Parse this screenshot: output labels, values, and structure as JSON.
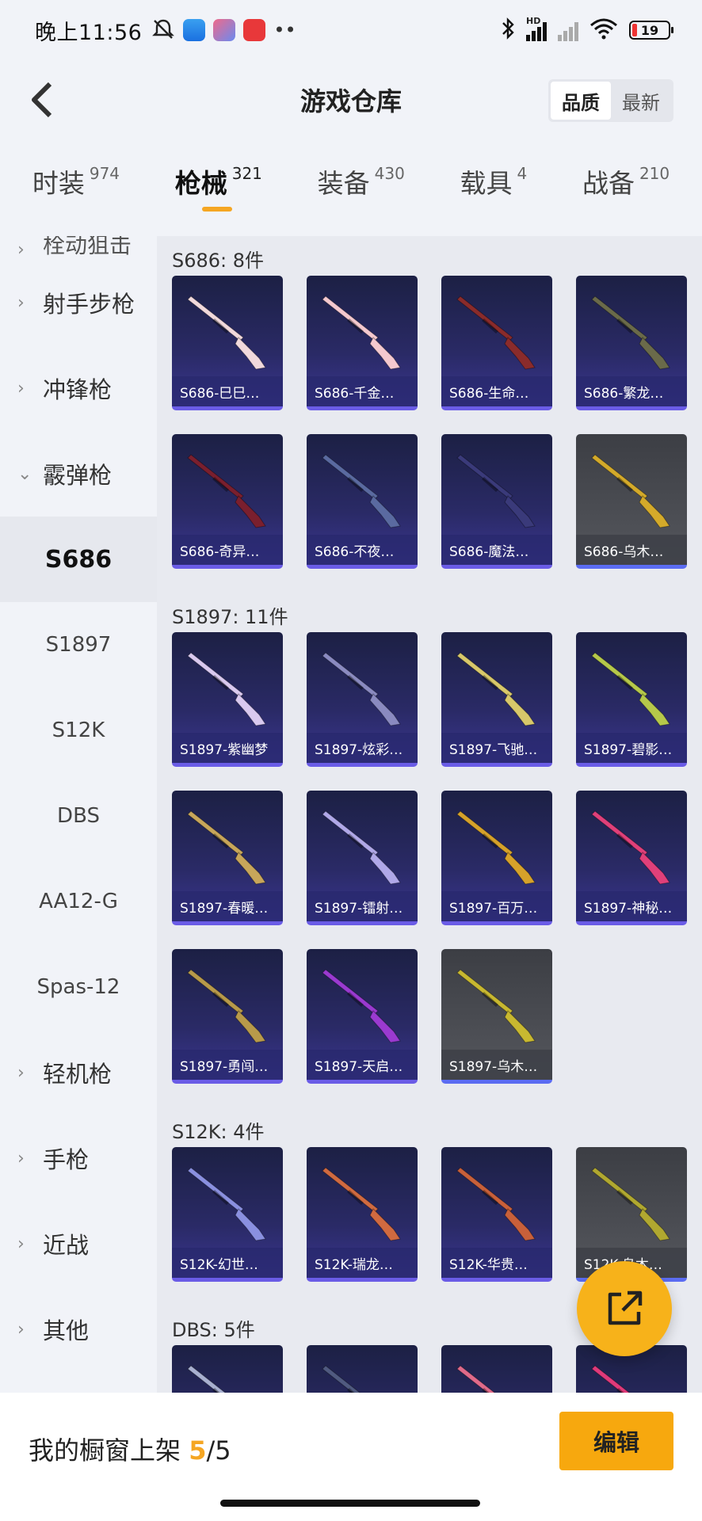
{
  "status": {
    "time": "晚上11:56",
    "battery": "19",
    "network": "HD"
  },
  "header": {
    "title": "游戏仓库",
    "sort_options": [
      "品质",
      "最新"
    ]
  },
  "tabs": [
    {
      "label": "时装",
      "count": "974"
    },
    {
      "label": "枪械",
      "count": "321"
    },
    {
      "label": "装备",
      "count": "430"
    },
    {
      "label": "载具",
      "count": "4"
    },
    {
      "label": "战备",
      "count": "210"
    }
  ],
  "sidebar": {
    "partial_top": "栓动狙击",
    "items": [
      {
        "label": "射手步枪"
      },
      {
        "label": "冲锋枪"
      },
      {
        "label": "霰弹枪"
      }
    ],
    "sub_items": [
      {
        "label": "S686"
      },
      {
        "label": "S1897"
      },
      {
        "label": "S12K"
      },
      {
        "label": "DBS"
      },
      {
        "label": "AA12-G"
      },
      {
        "label": "Spas-12"
      }
    ],
    "more_items": [
      {
        "label": "轻机枪"
      },
      {
        "label": "手枪"
      },
      {
        "label": "近战"
      },
      {
        "label": "其他"
      }
    ]
  },
  "groups": [
    {
      "title": "S686: 8件",
      "items": [
        {
          "name": "S686-巳巳…",
          "grey": false,
          "color": "#f1d9dc"
        },
        {
          "name": "S686-千金…",
          "grey": false,
          "color": "#f4c9cf"
        },
        {
          "name": "S686-生命…",
          "grey": false,
          "color": "#8a2b2b"
        },
        {
          "name": "S686-繁龙…",
          "grey": false,
          "color": "#6a6a4a"
        },
        {
          "name": "S686-奇异…",
          "grey": false,
          "color": "#7a1f2e"
        },
        {
          "name": "S686-不夜…",
          "grey": false,
          "color": "#5a6aa0"
        },
        {
          "name": "S686-魔法…",
          "grey": false,
          "color": "#3a3a7a"
        },
        {
          "name": "S686-乌木…",
          "grey": true,
          "color": "#d4aa2a"
        }
      ]
    },
    {
      "title": "S1897: 11件",
      "items": [
        {
          "name": "S1897-紫幽梦",
          "grey": false,
          "color": "#d9c9ef"
        },
        {
          "name": "S1897-炫彩…",
          "grey": false,
          "color": "#8a8ac0"
        },
        {
          "name": "S1897-飞驰…",
          "grey": false,
          "color": "#d8c86a"
        },
        {
          "name": "S1897-碧影…",
          "grey": false,
          "color": "#b6c84a"
        },
        {
          "name": "S1897-春暖…",
          "grey": false,
          "color": "#c8a65a"
        },
        {
          "name": "S1897-镭射…",
          "grey": false,
          "color": "#b0a8e8"
        },
        {
          "name": "S1897-百万…",
          "grey": false,
          "color": "#d6a22a"
        },
        {
          "name": "S1897-神秘…",
          "grey": false,
          "color": "#e0407a"
        },
        {
          "name": "S1897-勇闯…",
          "grey": false,
          "color": "#b89a4a"
        },
        {
          "name": "S1897-天启…",
          "grey": false,
          "color": "#9a3ad0"
        },
        {
          "name": "S1897-乌木…",
          "grey": true,
          "color": "#c8b830"
        }
      ]
    },
    {
      "title": "S12K: 4件",
      "items": [
        {
          "name": "S12K-幻世…",
          "grey": false,
          "color": "#8a90e0"
        },
        {
          "name": "S12K-瑞龙…",
          "grey": false,
          "color": "#d06a40"
        },
        {
          "name": "S12K-华贵…",
          "grey": false,
          "color": "#c8603a"
        },
        {
          "name": "S12K-乌木…",
          "grey": true,
          "color": "#b0a830"
        }
      ]
    },
    {
      "title": "DBS: 5件",
      "items": [
        {
          "name": "",
          "grey": false,
          "color": "#a8b0d0"
        },
        {
          "name": "",
          "grey": false,
          "color": "#505a80"
        },
        {
          "name": "",
          "grey": false,
          "color": "#e06a8a"
        },
        {
          "name": "",
          "grey": false,
          "color": "#e03a7a"
        }
      ]
    }
  ],
  "bottom": {
    "label": "我的橱窗上架 ",
    "current": "5",
    "total": "/5",
    "edit": "编辑"
  },
  "accent": "#f5a623"
}
